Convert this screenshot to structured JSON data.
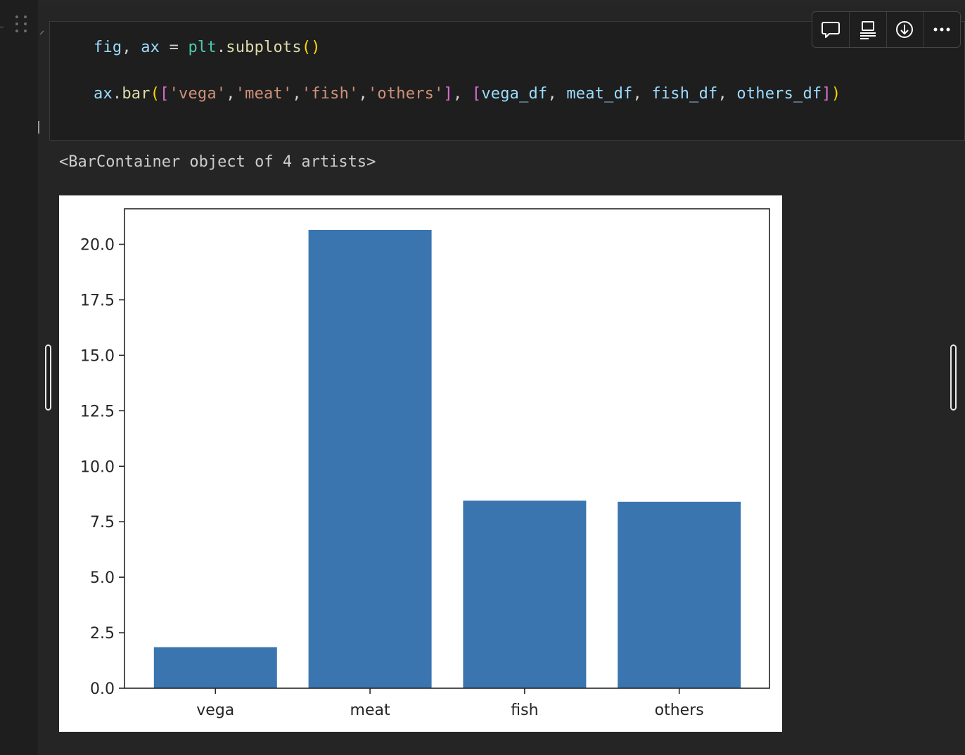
{
  "code": {
    "line1": {
      "fig": "fig",
      "comma": ", ",
      "ax": "ax",
      "eq": " = ",
      "plt": "plt",
      "dot": ".",
      "subplots": "subplots",
      "parens": "()"
    },
    "line2": {
      "ax": "ax",
      "dot": ".",
      "bar": "bar",
      "open_paren": "(",
      "open_bracket": "[",
      "s1": "'vega'",
      "s2": "'meat'",
      "s3": "'fish'",
      "s4": "'others'",
      "comma": ",",
      "close_bracket": "]",
      "sep": ", ",
      "open_bracket2": "[",
      "v1": "vega_df",
      "v2": "meat_df",
      "v3": "fish_df",
      "v4": "others_df",
      "listsep": ", ",
      "close_bracket2": "]",
      "close_paren": ")"
    }
  },
  "output": {
    "text": "<BarContainer object of 4 artists>"
  },
  "toolbar": {
    "icons": [
      "comment-icon",
      "split-cell-icon",
      "download-icon",
      "more-icon"
    ]
  },
  "chart_data": {
    "type": "bar",
    "categories": [
      "vega",
      "meat",
      "fish",
      "others"
    ],
    "values": [
      1.85,
      20.65,
      8.45,
      8.4
    ],
    "ylim": [
      0,
      21.6
    ],
    "yticks": [
      0.0,
      2.5,
      5.0,
      7.5,
      10.0,
      12.5,
      15.0,
      17.5,
      20.0
    ],
    "ytick_labels": [
      "0.0",
      "2.5",
      "5.0",
      "7.5",
      "10.0",
      "12.5",
      "15.0",
      "17.5",
      "20.0"
    ],
    "bar_color": "#3a75b0",
    "grid": false
  }
}
